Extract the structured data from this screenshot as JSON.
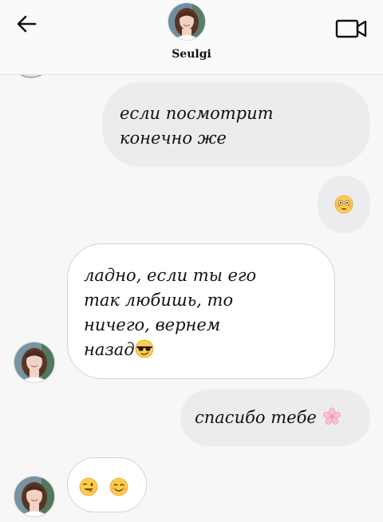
{
  "header": {
    "contact_name": "Seulgi",
    "back_icon": "arrow-left-icon",
    "video_icon": "video-camera-icon"
  },
  "messages": [
    {
      "direction": "outgoing",
      "lines": [
        "если посмотрит",
        "конечно же"
      ]
    },
    {
      "direction": "outgoing",
      "emoji": [
        "flushed-face-emoji"
      ]
    },
    {
      "direction": "incoming",
      "lines": [
        "ладно,  если ты его",
        "так любишь, то",
        "ничего, вернем",
        "назад"
      ],
      "trailing_emoji": "sunglasses-face-emoji"
    },
    {
      "direction": "outgoing",
      "lines": [
        "спасибо тебе"
      ],
      "trailing_emoji": "cherry-blossom-emoji"
    },
    {
      "direction": "incoming",
      "emoji": [
        "winking-tongue-face-emoji",
        "smiling-face-emoji"
      ]
    }
  ],
  "colors": {
    "outgoing_bubble": "#ececee",
    "incoming_bubble": "#ffffff",
    "background": "#f7f7f8"
  }
}
